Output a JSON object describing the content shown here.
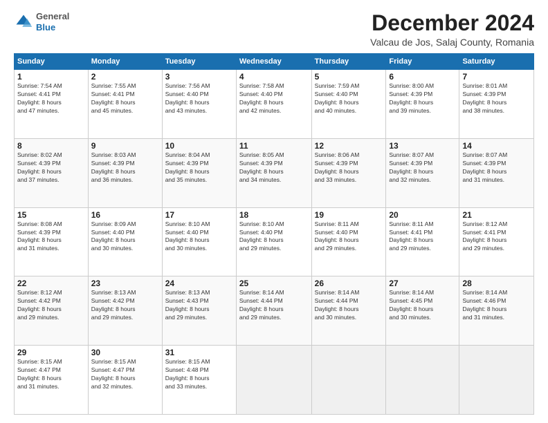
{
  "header": {
    "logo_general": "General",
    "logo_blue": "Blue",
    "title": "December 2024",
    "subtitle": "Valcau de Jos, Salaj County, Romania"
  },
  "columns": [
    "Sunday",
    "Monday",
    "Tuesday",
    "Wednesday",
    "Thursday",
    "Friday",
    "Saturday"
  ],
  "weeks": [
    {
      "row_class": "row-norm",
      "days": [
        {
          "num": "1",
          "info": "Sunrise: 7:54 AM\nSunset: 4:41 PM\nDaylight: 8 hours\nand 47 minutes."
        },
        {
          "num": "2",
          "info": "Sunrise: 7:55 AM\nSunset: 4:41 PM\nDaylight: 8 hours\nand 45 minutes."
        },
        {
          "num": "3",
          "info": "Sunrise: 7:56 AM\nSunset: 4:40 PM\nDaylight: 8 hours\nand 43 minutes."
        },
        {
          "num": "4",
          "info": "Sunrise: 7:58 AM\nSunset: 4:40 PM\nDaylight: 8 hours\nand 42 minutes."
        },
        {
          "num": "5",
          "info": "Sunrise: 7:59 AM\nSunset: 4:40 PM\nDaylight: 8 hours\nand 40 minutes."
        },
        {
          "num": "6",
          "info": "Sunrise: 8:00 AM\nSunset: 4:39 PM\nDaylight: 8 hours\nand 39 minutes."
        },
        {
          "num": "7",
          "info": "Sunrise: 8:01 AM\nSunset: 4:39 PM\nDaylight: 8 hours\nand 38 minutes."
        }
      ]
    },
    {
      "row_class": "row-alt",
      "days": [
        {
          "num": "8",
          "info": "Sunrise: 8:02 AM\nSunset: 4:39 PM\nDaylight: 8 hours\nand 37 minutes."
        },
        {
          "num": "9",
          "info": "Sunrise: 8:03 AM\nSunset: 4:39 PM\nDaylight: 8 hours\nand 36 minutes."
        },
        {
          "num": "10",
          "info": "Sunrise: 8:04 AM\nSunset: 4:39 PM\nDaylight: 8 hours\nand 35 minutes."
        },
        {
          "num": "11",
          "info": "Sunrise: 8:05 AM\nSunset: 4:39 PM\nDaylight: 8 hours\nand 34 minutes."
        },
        {
          "num": "12",
          "info": "Sunrise: 8:06 AM\nSunset: 4:39 PM\nDaylight: 8 hours\nand 33 minutes."
        },
        {
          "num": "13",
          "info": "Sunrise: 8:07 AM\nSunset: 4:39 PM\nDaylight: 8 hours\nand 32 minutes."
        },
        {
          "num": "14",
          "info": "Sunrise: 8:07 AM\nSunset: 4:39 PM\nDaylight: 8 hours\nand 31 minutes."
        }
      ]
    },
    {
      "row_class": "row-norm",
      "days": [
        {
          "num": "15",
          "info": "Sunrise: 8:08 AM\nSunset: 4:39 PM\nDaylight: 8 hours\nand 31 minutes."
        },
        {
          "num": "16",
          "info": "Sunrise: 8:09 AM\nSunset: 4:40 PM\nDaylight: 8 hours\nand 30 minutes."
        },
        {
          "num": "17",
          "info": "Sunrise: 8:10 AM\nSunset: 4:40 PM\nDaylight: 8 hours\nand 30 minutes."
        },
        {
          "num": "18",
          "info": "Sunrise: 8:10 AM\nSunset: 4:40 PM\nDaylight: 8 hours\nand 29 minutes."
        },
        {
          "num": "19",
          "info": "Sunrise: 8:11 AM\nSunset: 4:40 PM\nDaylight: 8 hours\nand 29 minutes."
        },
        {
          "num": "20",
          "info": "Sunrise: 8:11 AM\nSunset: 4:41 PM\nDaylight: 8 hours\nand 29 minutes."
        },
        {
          "num": "21",
          "info": "Sunrise: 8:12 AM\nSunset: 4:41 PM\nDaylight: 8 hours\nand 29 minutes."
        }
      ]
    },
    {
      "row_class": "row-alt",
      "days": [
        {
          "num": "22",
          "info": "Sunrise: 8:12 AM\nSunset: 4:42 PM\nDaylight: 8 hours\nand 29 minutes."
        },
        {
          "num": "23",
          "info": "Sunrise: 8:13 AM\nSunset: 4:42 PM\nDaylight: 8 hours\nand 29 minutes."
        },
        {
          "num": "24",
          "info": "Sunrise: 8:13 AM\nSunset: 4:43 PM\nDaylight: 8 hours\nand 29 minutes."
        },
        {
          "num": "25",
          "info": "Sunrise: 8:14 AM\nSunset: 4:44 PM\nDaylight: 8 hours\nand 29 minutes."
        },
        {
          "num": "26",
          "info": "Sunrise: 8:14 AM\nSunset: 4:44 PM\nDaylight: 8 hours\nand 30 minutes."
        },
        {
          "num": "27",
          "info": "Sunrise: 8:14 AM\nSunset: 4:45 PM\nDaylight: 8 hours\nand 30 minutes."
        },
        {
          "num": "28",
          "info": "Sunrise: 8:14 AM\nSunset: 4:46 PM\nDaylight: 8 hours\nand 31 minutes."
        }
      ]
    },
    {
      "row_class": "row-norm",
      "days": [
        {
          "num": "29",
          "info": "Sunrise: 8:15 AM\nSunset: 4:47 PM\nDaylight: 8 hours\nand 31 minutes."
        },
        {
          "num": "30",
          "info": "Sunrise: 8:15 AM\nSunset: 4:47 PM\nDaylight: 8 hours\nand 32 minutes."
        },
        {
          "num": "31",
          "info": "Sunrise: 8:15 AM\nSunset: 4:48 PM\nDaylight: 8 hours\nand 33 minutes."
        },
        null,
        null,
        null,
        null
      ]
    }
  ]
}
